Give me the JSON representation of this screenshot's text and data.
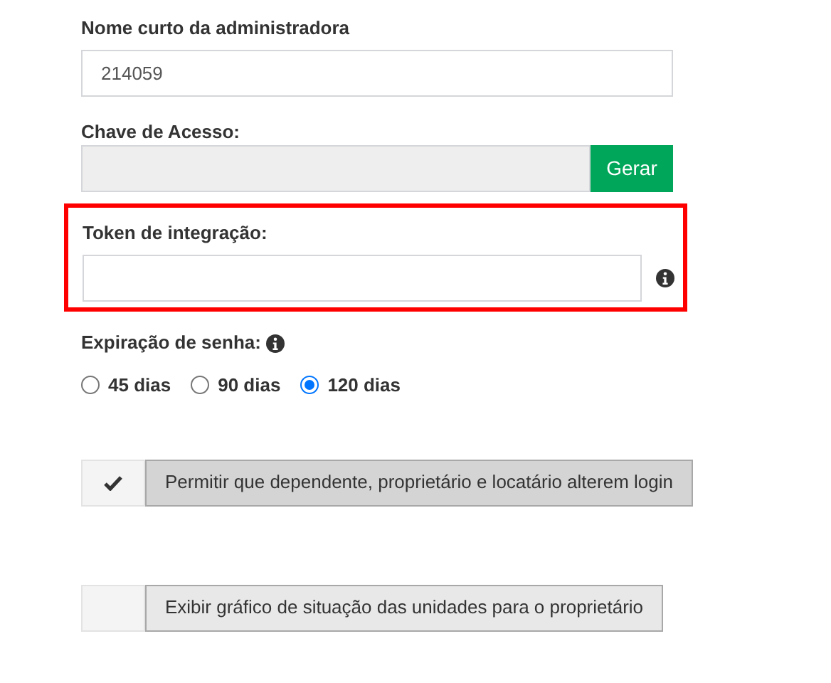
{
  "admin_short_name": {
    "label": "Nome curto da administradora",
    "value": "214059"
  },
  "access_key": {
    "label": "Chave de Acesso:",
    "button": "Gerar"
  },
  "integration_token": {
    "label": "Token de integração:",
    "highlighted": true
  },
  "password_expiration": {
    "label": "Expiração de senha:",
    "options": [
      {
        "label": "45 dias",
        "selected": false
      },
      {
        "label": "90 dias",
        "selected": false
      },
      {
        "label": "120 dias",
        "selected": true
      }
    ]
  },
  "toggles": [
    {
      "label": "Permitir que dependente, proprietário e locatário alterem login",
      "checked": true
    },
    {
      "label": "Exibir gráfico de situação das unidades para o proprietário",
      "checked": false
    }
  ]
}
